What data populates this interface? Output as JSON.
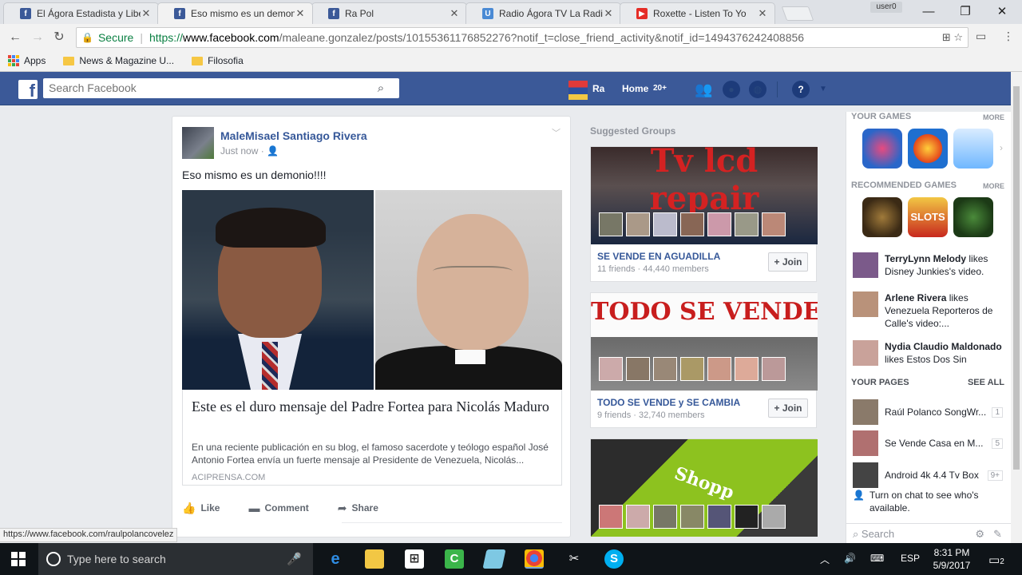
{
  "browser": {
    "tabs": [
      {
        "title": "El Ágora Estadista y Libe",
        "favicon": "facebook-icon",
        "color": "#3b5998"
      },
      {
        "title": "Eso mismo es un demon",
        "favicon": "facebook-icon",
        "color": "#3b5998"
      },
      {
        "title": "Ra Pol",
        "favicon": "facebook-icon",
        "color": "#3b5998"
      },
      {
        "title": "Radio Ágora TV La Radio",
        "favicon": "u-icon",
        "color": "#4a8ad4"
      },
      {
        "title": "Roxette - Listen To Yo",
        "favicon": "youtube-icon",
        "color": "#e52d27"
      }
    ],
    "user_badge": "user0",
    "secure_label": "Secure",
    "url_scheme": "https://",
    "url_host": "www.facebook.com",
    "url_path": "/maleane.gonzalez/posts/10155361176852276?notif_t=close_friend_activity&notif_id=1494376242408856",
    "bookmarks": [
      "Apps",
      "News & Magazine U...",
      "Filosofia"
    ],
    "status_url": "https://www.facebook.com/raulpolancovelez"
  },
  "fb": {
    "search_placeholder": "Search Facebook",
    "user_name": "Ra",
    "home_label": "Home",
    "home_count": "20+"
  },
  "post": {
    "author": "MaleMisael Santiago Rivera",
    "time": "Just now",
    "text": "Eso mismo es un demonio!!!!",
    "link_title": "Este es el duro mensaje del Padre Fortea para Nicolás Maduro",
    "link_desc": "En una reciente publicación en su blog, el famoso sacerdote y teólogo español José Antonio Fortea envía un fuerte mensaje al Presidente de Venezuela, Nicolás...",
    "link_source": "ACIPRENSA.COM",
    "actions": {
      "like": "Like",
      "comment": "Comment",
      "share": "Share"
    }
  },
  "suggested": {
    "title": "Suggested Groups",
    "join_label": "Join",
    "groups": [
      {
        "banner": "Tv lcd repair",
        "name": "SE VENDE EN AGUADILLA",
        "meta": "11 friends · 44,440 members"
      },
      {
        "banner": "TODO SE VENDE y SE CAMBI",
        "name": "TODO SE VENDE y SE CAMBIA",
        "meta": "9 friends · 32,740 members"
      },
      {
        "banner": "Shopp",
        "name": "",
        "meta": ""
      }
    ]
  },
  "sidebar": {
    "your_games": "YOUR GAMES",
    "more": "MORE",
    "recommended_games": "RECOMMENDED GAMES",
    "games_recommended_text": [
      "SLOTS"
    ],
    "ticker": [
      {
        "name": "TerryLynn Melody",
        "action": "likes Disney Junkies's video."
      },
      {
        "name": "Arlene Rivera",
        "action": "likes Venezuela Reporteros de Calle's video:..."
      },
      {
        "name": "Nydia Claudio Maldonado",
        "action": "likes Estos Dos Sin"
      }
    ],
    "your_pages": "YOUR PAGES",
    "see_all": "SEE ALL",
    "pages": [
      {
        "name": "Raúl Polanco SongWr...",
        "count": "1"
      },
      {
        "name": "Se Vende Casa en M...",
        "count": "5"
      },
      {
        "name": "Android 4k 4.4 Tv Box",
        "count": "9+"
      }
    ],
    "chat_prompt": "Turn on chat to see who's available.",
    "chat_search": "Search"
  },
  "taskbar": {
    "search_placeholder": "Type here to search",
    "language": "ESP",
    "time": "8:31 PM",
    "date": "5/9/2017",
    "notifications": "2"
  }
}
